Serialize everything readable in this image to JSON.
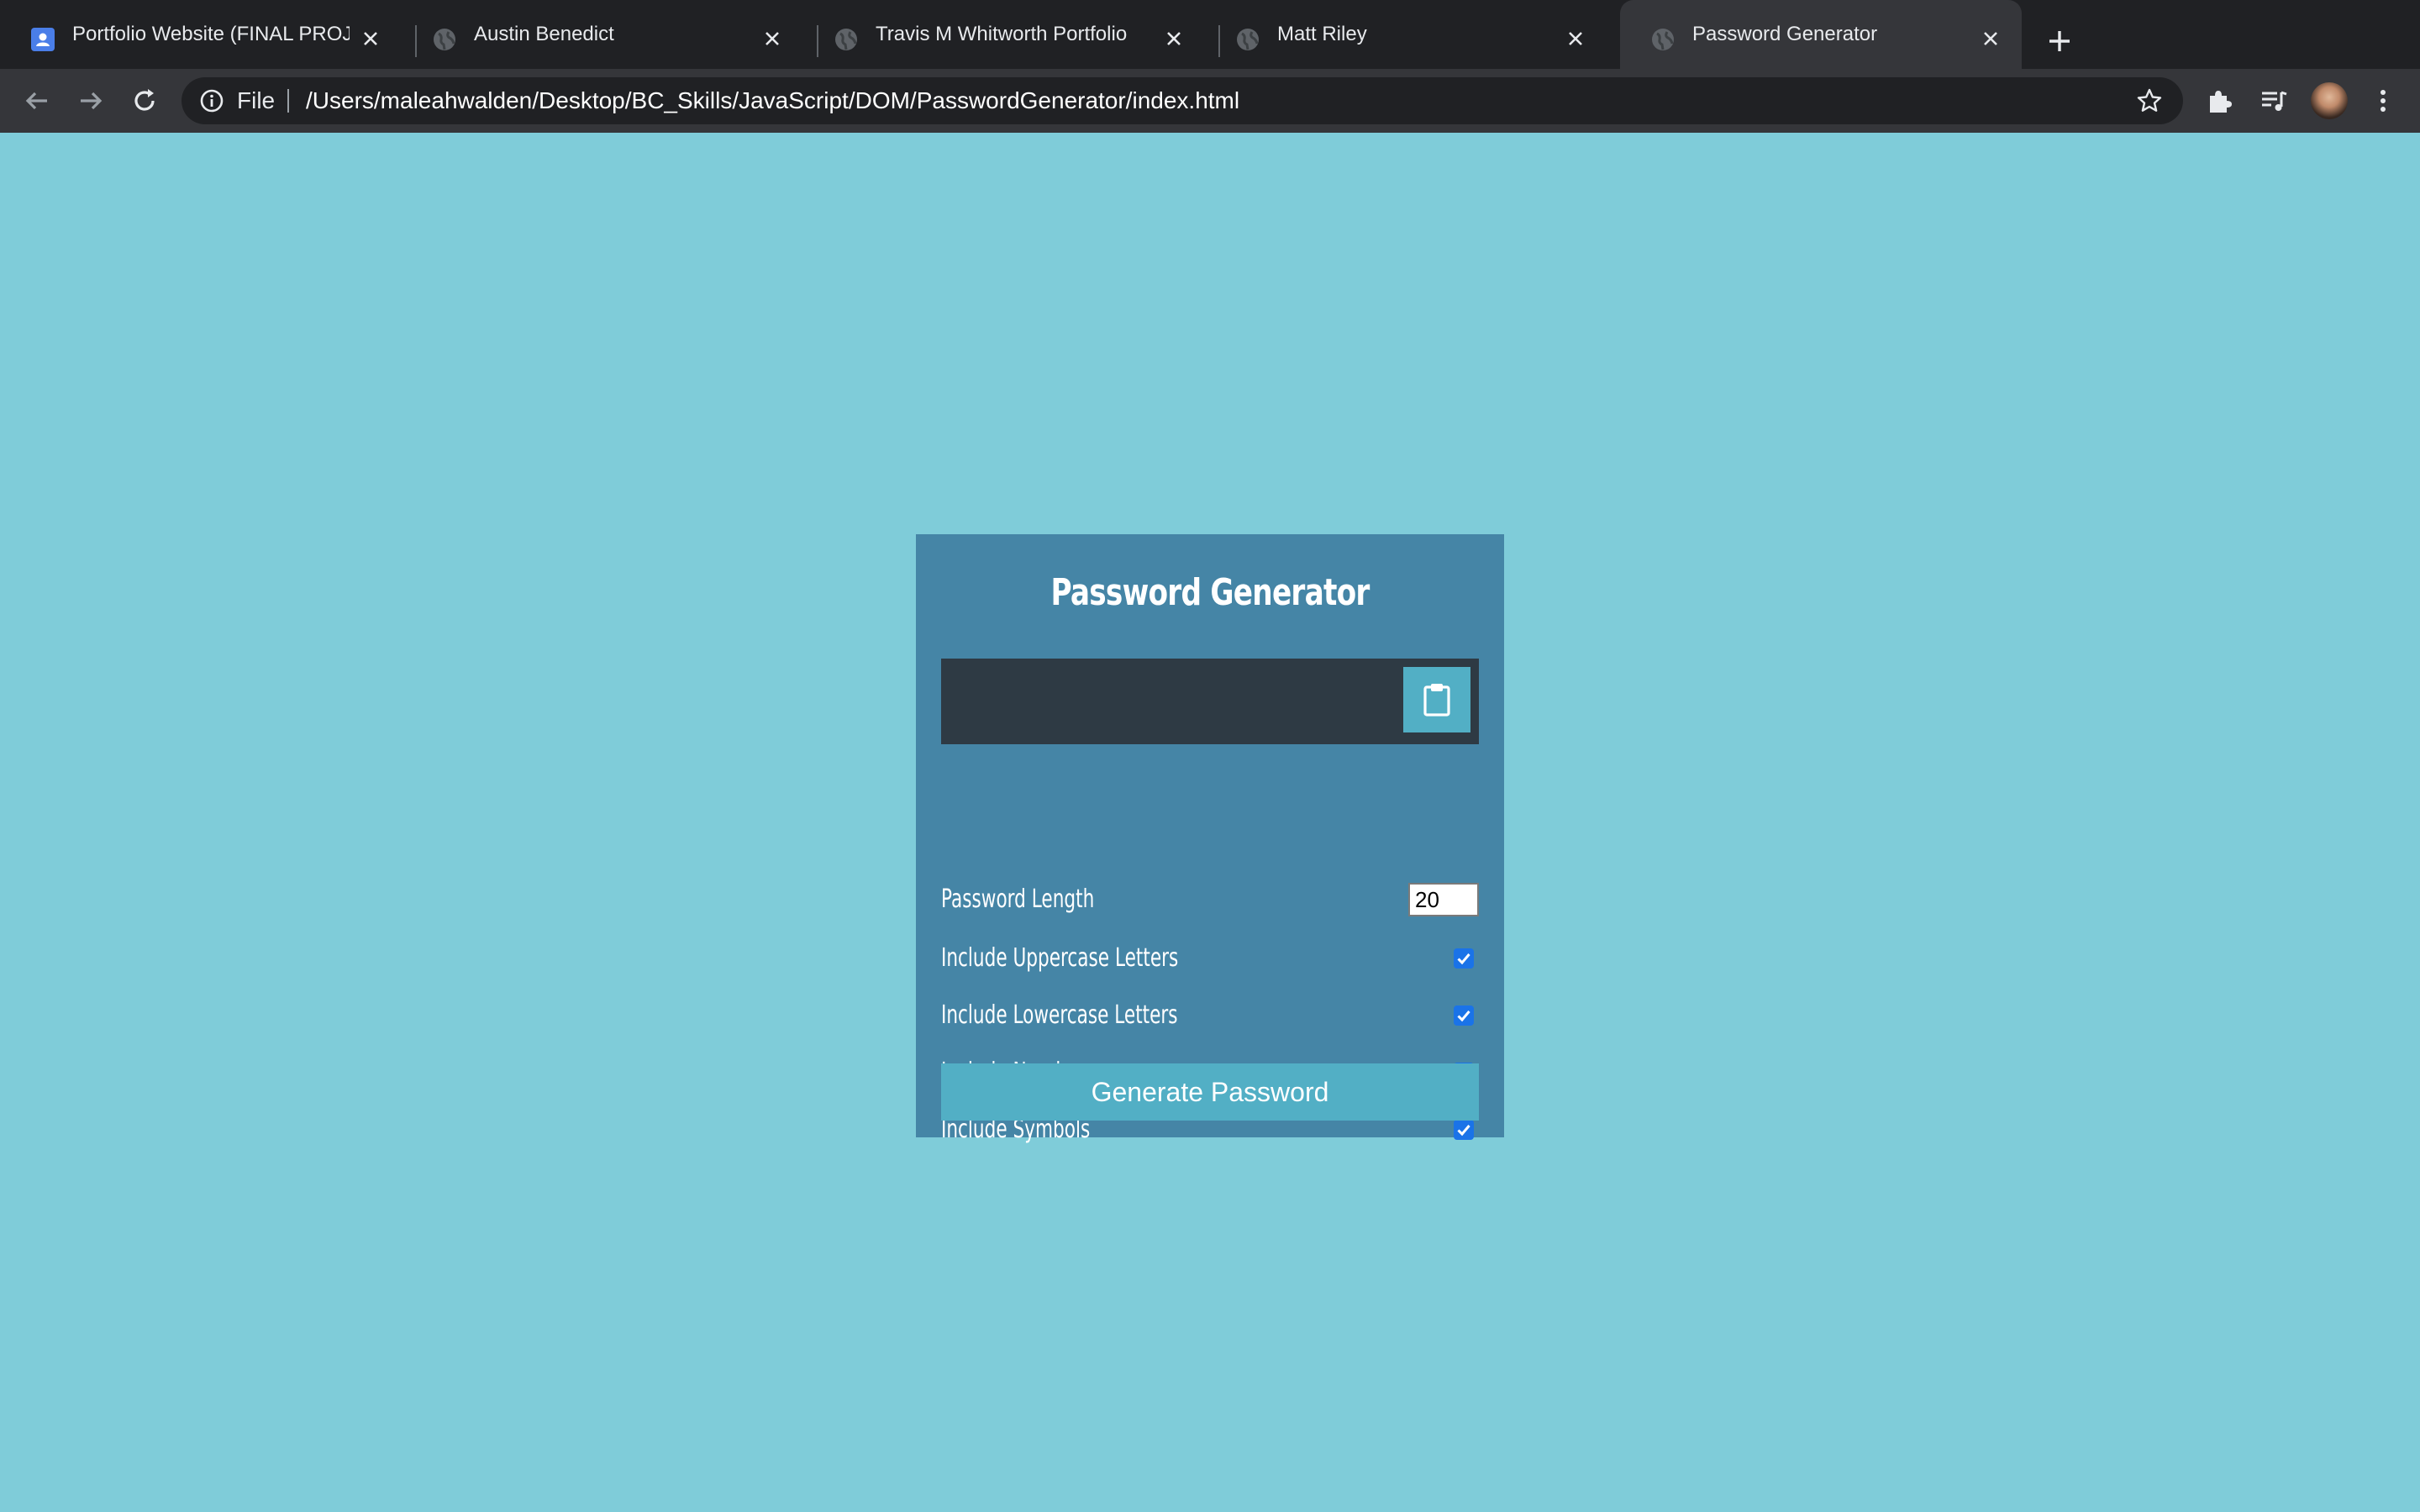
{
  "browser": {
    "tabs": [
      {
        "title": "Portfolio Website (FINAL PROJ",
        "favicon": "contact-card-icon",
        "active": false
      },
      {
        "title": "Austin Benedict",
        "favicon": "globe-icon",
        "active": false
      },
      {
        "title": "Travis M Whitworth Portfolio",
        "favicon": "globe-icon",
        "active": false
      },
      {
        "title": "Matt Riley",
        "favicon": "globe-icon",
        "active": false
      },
      {
        "title": "Password Generator",
        "favicon": "globe-icon",
        "active": true
      }
    ],
    "omnibox": {
      "scheme_label": "File",
      "url": "/Users/maleahwalden/Desktop/BC_Skills/JavaScript/DOM/PasswordGenerator/index.html"
    },
    "colors": {
      "tabstrip": "#202124",
      "toolbar": "#35363a"
    }
  },
  "app": {
    "title": "Password Generator",
    "result": "",
    "clipboard_icon": "clipboard-icon",
    "length_label": "Password Length",
    "length_value": "20",
    "options": [
      {
        "label": "Include Uppercase Letters",
        "checked": true
      },
      {
        "label": "Include Lowercase Letters",
        "checked": true
      },
      {
        "label": "Include Numbers",
        "checked": true
      },
      {
        "label": "Include Symbols",
        "checked": true
      }
    ],
    "generate_label": "Generate Password",
    "colors": {
      "page_bg": "#7fccd9",
      "card_bg": "#4585a6",
      "result_bg": "#2e3a44",
      "button_bg": "#52afc5",
      "checkbox": "#1a73e8"
    }
  }
}
